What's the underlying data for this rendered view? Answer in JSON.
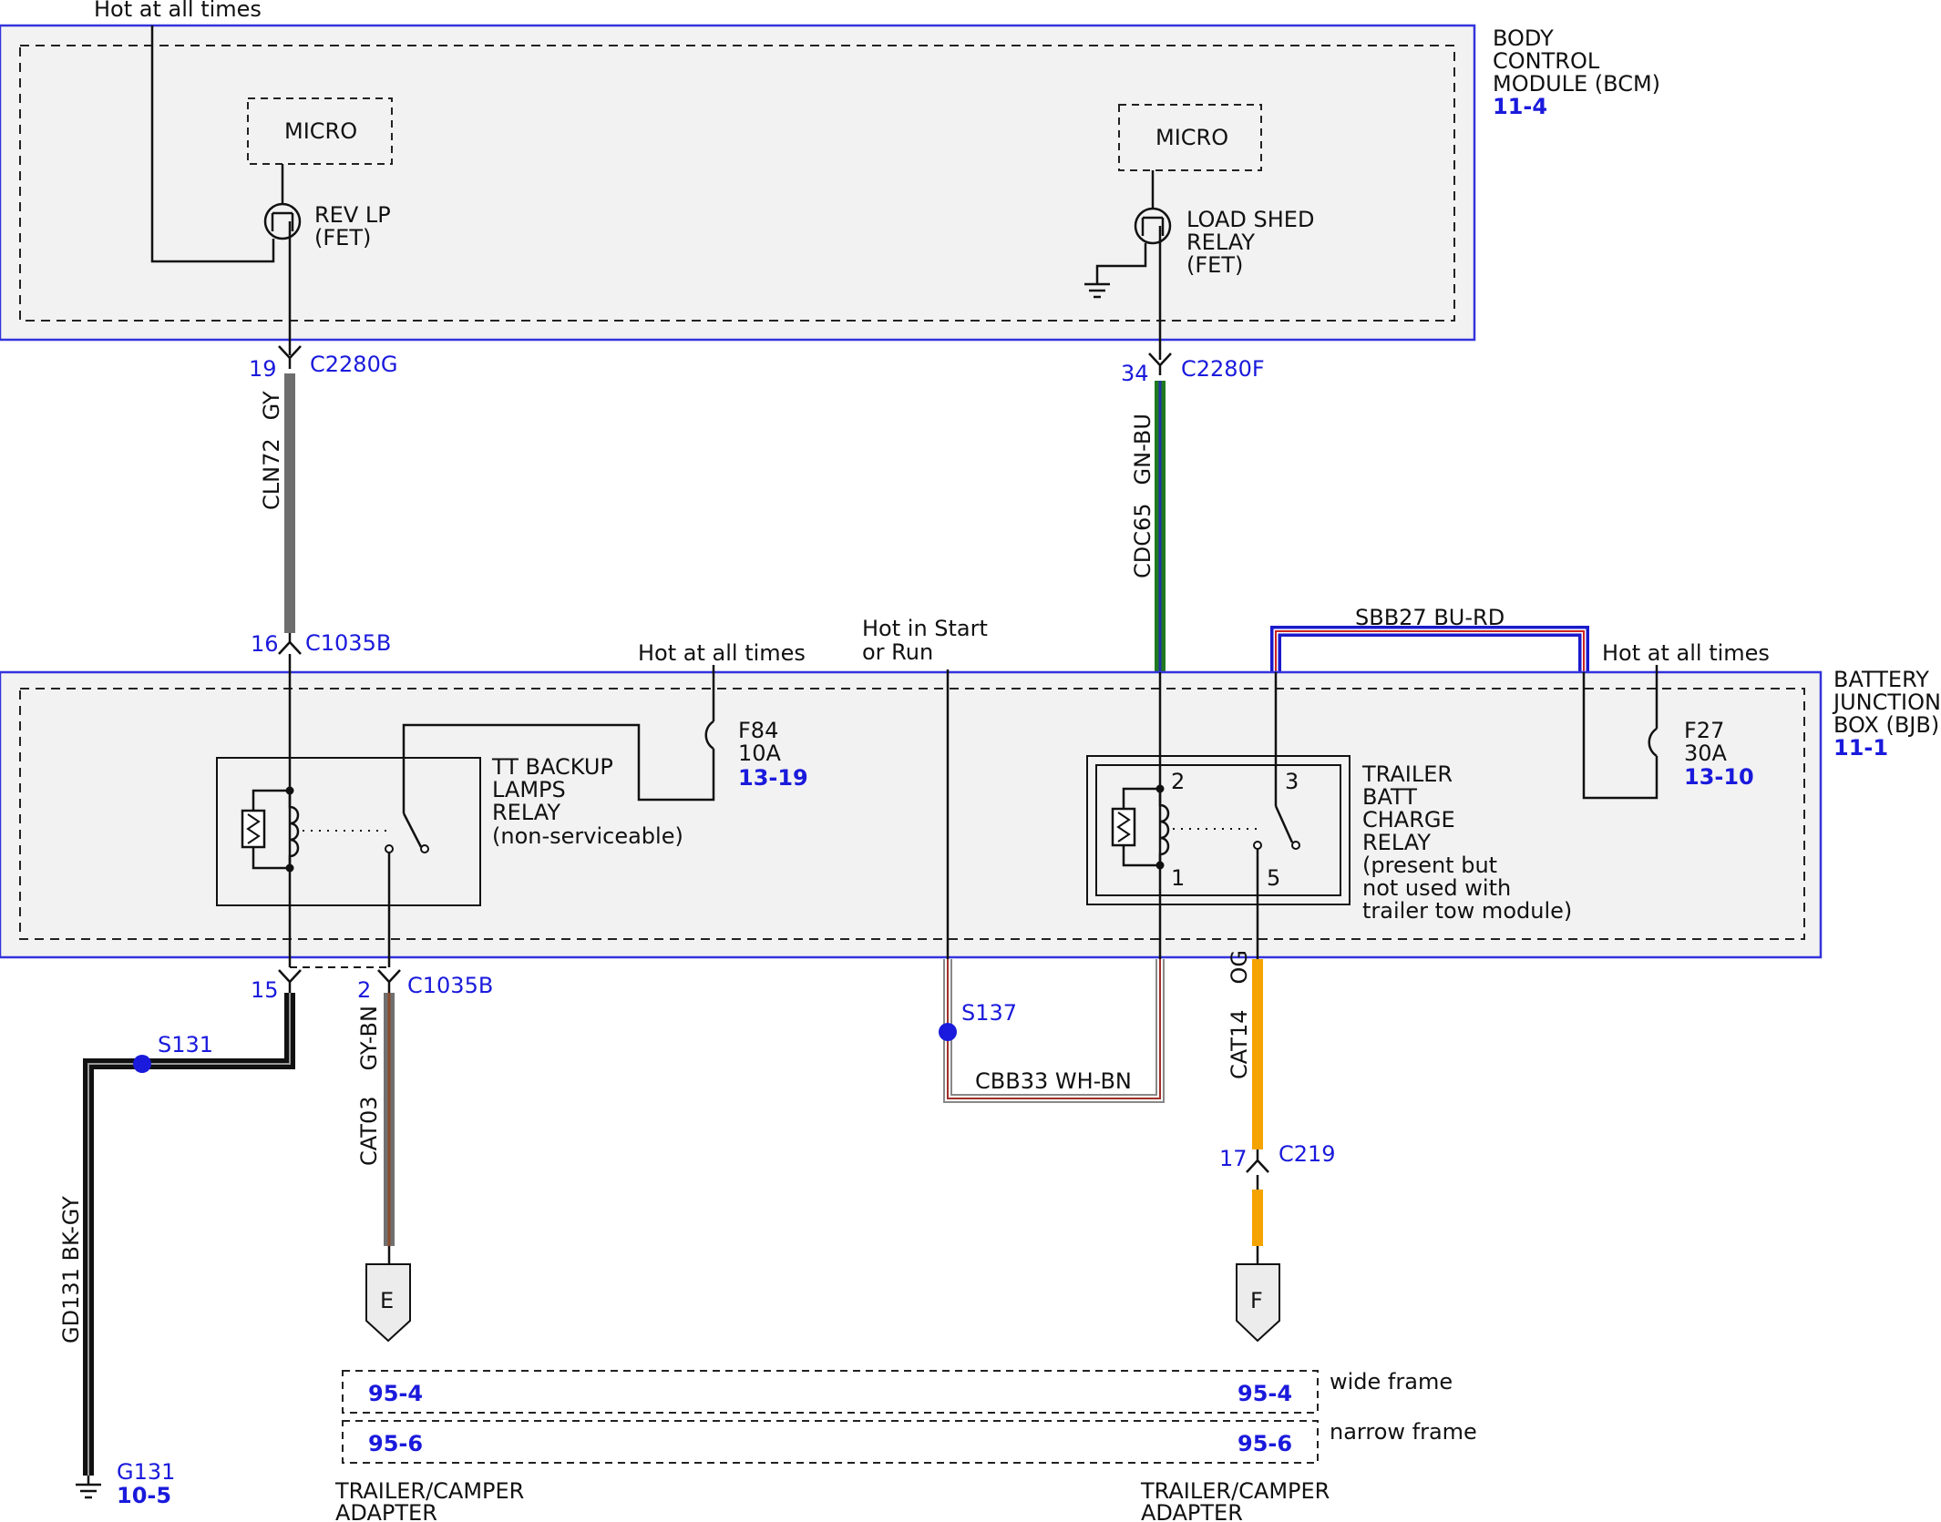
{
  "bcm": {
    "title_lines": [
      "BODY",
      "CONTROL",
      "MODULE (BCM)"
    ],
    "ref": "11-4",
    "hot_label": "Hot at all times",
    "micro_left": "MICRO",
    "micro_right": "MICRO",
    "rev_lp_lines": [
      "REV LP",
      "(FET)"
    ],
    "load_shed_lines": [
      "LOAD SHED",
      "RELAY",
      "(FET)"
    ]
  },
  "connectors": {
    "c2280g": {
      "pin": "19",
      "name": "C2280G"
    },
    "c2280f": {
      "pin": "34",
      "name": "C2280F"
    },
    "c1035b_top": {
      "pin": "16",
      "name": "C1035B"
    },
    "c1035b_15": {
      "pin": "15"
    },
    "c1035b_2": {
      "pin": "2",
      "name": "C1035B"
    },
    "c219": {
      "pin": "17",
      "name": "C219"
    }
  },
  "wires": {
    "cln72": {
      "circuit": "CLN72",
      "color": "GY"
    },
    "cdc65": {
      "circuit": "CDC65",
      "color": "GN-BU"
    },
    "sbb27": {
      "label": "SBB27  BU-RD"
    },
    "gd131": {
      "label": "GD131  BK-GY"
    },
    "cat03": {
      "circuit": "CAT03",
      "color": "GY-BN"
    },
    "cbb33": {
      "label": "CBB33  WH-BN"
    },
    "cat14": {
      "circuit": "CAT14",
      "color": "OG"
    }
  },
  "bjb": {
    "title_lines": [
      "BATTERY",
      "JUNCTION",
      "BOX (BJB)"
    ],
    "ref": "11-1",
    "hot_left": "Hot at all times",
    "hot_start_lines": [
      "Hot in Start",
      "or Run"
    ],
    "hot_right": "Hot at all times",
    "f84_lines": [
      "F84",
      "10A"
    ],
    "f84_ref": "13-19",
    "f27_lines": [
      "F27",
      "30A"
    ],
    "f27_ref": "13-10",
    "tt_relay_lines": [
      "TT BACKUP",
      "LAMPS",
      "RELAY",
      "(non-serviceable)"
    ],
    "trailer_relay_lines": [
      "TRAILER",
      "BATT",
      "CHARGE",
      "RELAY",
      "(present but",
      "not used with",
      "trailer tow module)"
    ],
    "pins": {
      "p1": "1",
      "p2": "2",
      "p3": "3",
      "p5": "5"
    }
  },
  "splices": {
    "s131": "S131",
    "s137": "S137"
  },
  "ground": {
    "name": "G131",
    "ref": "10-5"
  },
  "terminals": {
    "e": "E",
    "f": "F"
  },
  "frames": {
    "wide": {
      "left_ref": "95-4",
      "right_ref": "95-4",
      "label": "wide frame"
    },
    "narrow": {
      "left_ref": "95-6",
      "right_ref": "95-6",
      "label": "narrow frame"
    }
  },
  "adapter_left_lines": [
    "TRAILER/CAMPER",
    "ADAPTER"
  ],
  "adapter_right_lines": [
    "TRAILER/CAMPER",
    "ADAPTER"
  ]
}
